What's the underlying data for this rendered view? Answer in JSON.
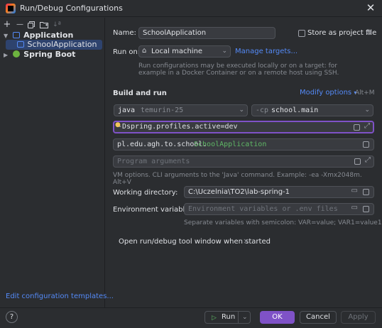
{
  "window": {
    "title": "Run/Debug Configurations",
    "close_glyph": "✕"
  },
  "toolbar": {
    "add": "+",
    "remove": "—",
    "copy_icon": "copy-icon",
    "folder_icon": "folder-icon",
    "sort": "↓ª"
  },
  "tree": {
    "application_label": "Application",
    "school_app_label": "SchoolApplication",
    "spring_boot_label": "Spring Boot"
  },
  "edit_templates_link": "Edit configuration templates...",
  "form": {
    "name_label": "Name:",
    "name_value": "SchoolApplication",
    "store_label": "Store as project file",
    "run_on_label": "Run on:",
    "run_on_value": "Local machine",
    "manage_targets": "Manage targets...",
    "run_on_hint_1": "Run configurations may be executed locally or on a target: for",
    "run_on_hint_2": "example in a Docker Container or on a remote host using SSH.",
    "section_title": "Build and run",
    "modify_options": "Modify options",
    "modify_shortcut": "Alt+M",
    "jdk_kind": "java",
    "jdk_version": "temurin-25",
    "cp_flag": "-cp",
    "cp_value": "school.main",
    "vm_options_prefix": "-",
    "vm_options_value": "Dspring.profiles.active=dev",
    "main_class_pkg": "pl.edu.agh.to.school.",
    "main_class_name": "SchoolApplication",
    "program_args_placeholder": "Program arguments",
    "vm_hint": "VM options. CLI arguments to the 'Java' command. Example: -ea -Xmx2048m. Alt+V",
    "workdir_label": "Working directory:",
    "workdir_value": "C:\\Uczelnia\\TO2\\lab-spring-1",
    "env_label": "Environment variables:",
    "env_placeholder": "Environment variables or .env files",
    "env_hint": "Separate variables with semicolon: VAR=value; VAR1=value1",
    "tool_window_label": "Open run/debug tool window when started",
    "tool_window_remove": "×"
  },
  "buttons": {
    "help": "?",
    "run": "Run",
    "ok": "OK",
    "cancel": "Cancel",
    "apply": "Apply"
  },
  "colors": {
    "accent": "#7f52c7",
    "link": "#548af7",
    "selection": "#2e436e",
    "run_green": "#5fb865"
  }
}
